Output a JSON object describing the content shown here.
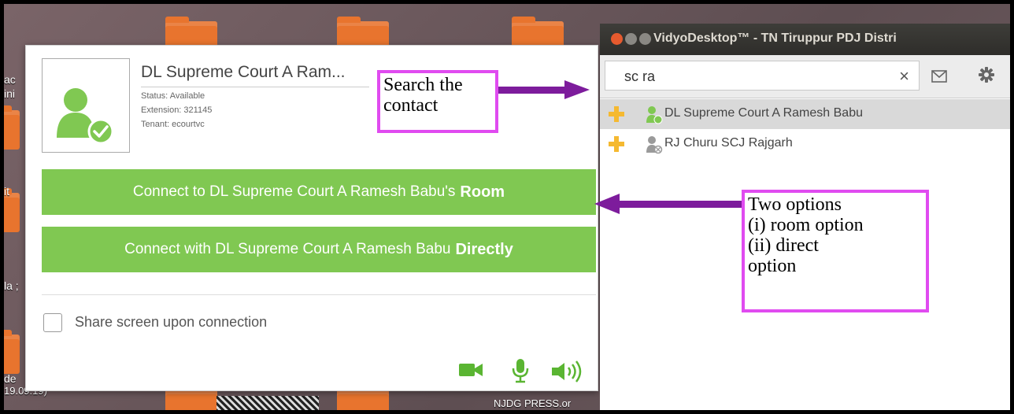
{
  "desktop": {
    "labels": [
      "ac",
      "ini",
      "it",
      "la ;",
      "de",
      "19.09.19)",
      "NJDG PRESS.or"
    ]
  },
  "contact_card": {
    "name": "DL Supreme Court A Ram...",
    "status": "Status: Available",
    "extension": "Extension: 321145",
    "tenant": "Tenant: ecourtvc",
    "room_button": {
      "prefix": "Connect to DL Supreme Court A Ramesh Babu's",
      "bold": "Room"
    },
    "direct_button": {
      "prefix": "Connect with DL Supreme Court A Ramesh Babu",
      "bold": "Directly"
    },
    "share_label": "Share screen upon connection",
    "icons": [
      "video-camera-icon",
      "microphone-icon",
      "speaker-icon"
    ]
  },
  "vidyo": {
    "title": "VidyoDesktop™ - TN Tiruppur PDJ Distri",
    "search_value": "sc ra",
    "clear_symbol": "×",
    "contacts": [
      {
        "name": "DL Supreme Court A Ramesh Babu",
        "status": "available"
      },
      {
        "name": "RJ Churu SCJ Rajgarh",
        "status": "offline"
      }
    ]
  },
  "annotations": {
    "search_note": "Search the\ncontact",
    "options_note": "Two options\n(i) room option\n(ii) direct\noption"
  },
  "colors": {
    "accent_green": "#80c852",
    "callout_border": "#e04bf0",
    "arrow": "#7d1c9c",
    "plus": "#f5b931"
  }
}
